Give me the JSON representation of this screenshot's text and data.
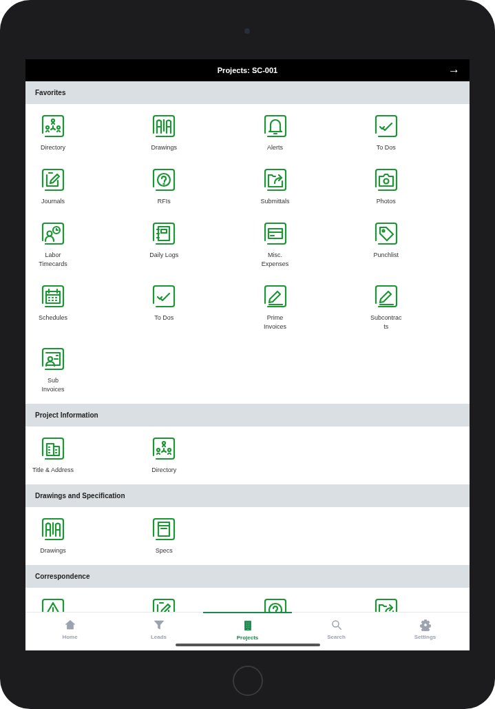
{
  "header": {
    "title": "Projects: SC-001",
    "action": "→"
  },
  "sections": [
    {
      "title": "Favorites",
      "items": [
        {
          "label": "Directory",
          "kind": "directory"
        },
        {
          "label": "Drawings",
          "kind": "drawings"
        },
        {
          "label": "Alerts",
          "kind": "bell"
        },
        {
          "label": "To Dos",
          "kind": "todo"
        },
        {
          "label": "Journals",
          "kind": "journal"
        },
        {
          "label": "RFIs",
          "kind": "question"
        },
        {
          "label": "Submittals",
          "kind": "share"
        },
        {
          "label": "Photos",
          "kind": "camera"
        },
        {
          "label": "Labor\nTimecards",
          "kind": "timecard"
        },
        {
          "label": "Daily Logs",
          "kind": "notebook"
        },
        {
          "label": "Misc.\nExpenses",
          "kind": "card"
        },
        {
          "label": "Punchlist",
          "kind": "tag"
        },
        {
          "label": "Schedules",
          "kind": "calendar"
        },
        {
          "label": "To Dos",
          "kind": "todo"
        },
        {
          "label": "Prime\nInvoices",
          "kind": "pencil"
        },
        {
          "label": "Subcontrac\nts",
          "kind": "pencil"
        },
        {
          "label": "Sub\nInvoices",
          "kind": "subinvoice"
        }
      ]
    },
    {
      "title": "Project Information",
      "items": [
        {
          "label": "Title & Address",
          "kind": "building"
        },
        {
          "label": "Directory",
          "kind": "directory"
        }
      ]
    },
    {
      "title": "Drawings and Specification",
      "items": [
        {
          "label": "Drawings",
          "kind": "drawings"
        },
        {
          "label": "Specs",
          "kind": "specs"
        }
      ]
    },
    {
      "title": "Correspondence",
      "items": [
        {
          "kind": "warning"
        },
        {
          "kind": "journal"
        },
        {
          "kind": "question"
        },
        {
          "kind": "share"
        }
      ]
    }
  ],
  "tabs": [
    {
      "label": "Home",
      "kind": "home",
      "selected": false
    },
    {
      "label": "Leads",
      "kind": "filter",
      "selected": false
    },
    {
      "label": "Projects",
      "kind": "office",
      "selected": true
    },
    {
      "label": "Search",
      "kind": "search",
      "selected": false
    },
    {
      "label": "Settings",
      "kind": "gear",
      "selected": false
    }
  ]
}
